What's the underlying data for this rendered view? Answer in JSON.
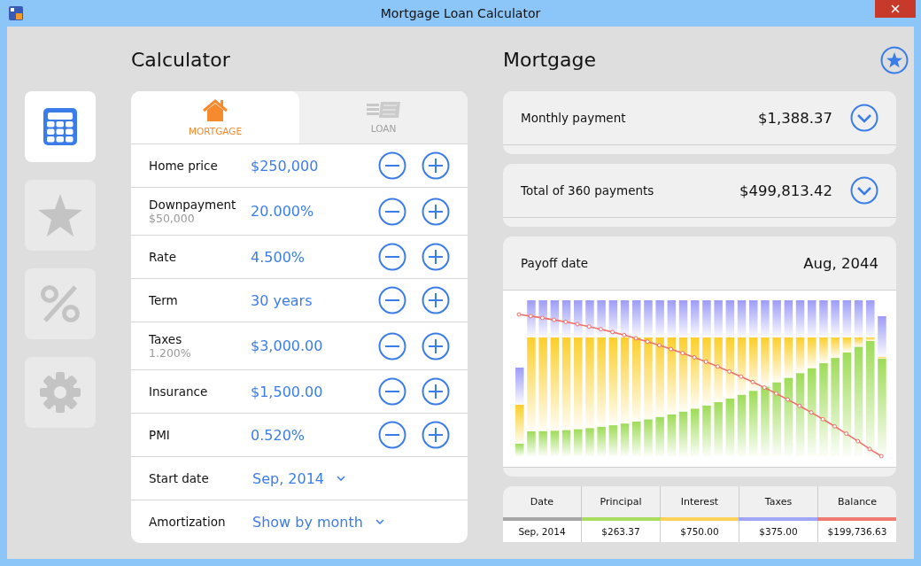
{
  "window": {
    "title": "Mortgage Loan Calculator"
  },
  "sidebar": {
    "items": [
      {
        "selected": true
      },
      {
        "selected": false
      },
      {
        "selected": false
      },
      {
        "selected": false
      }
    ]
  },
  "calculator": {
    "title": "Calculator",
    "tabs": [
      {
        "label": "MORTGAGE",
        "selected": true
      },
      {
        "label": "LOAN",
        "selected": false
      }
    ],
    "rows": [
      {
        "kind": "stepper",
        "label": "Home price",
        "value": "$250,000"
      },
      {
        "kind": "stepper",
        "label": "Downpayment",
        "sub": "$50,000",
        "value": "20.000%"
      },
      {
        "kind": "stepper",
        "label": "Rate",
        "value": "4.500%"
      },
      {
        "kind": "stepper",
        "label": "Term",
        "value": "30 years"
      },
      {
        "kind": "stepper",
        "label": "Taxes",
        "sub": "1.200%",
        "value": "$3,000.00"
      },
      {
        "kind": "stepper",
        "label": "Insurance",
        "value": "$1,500.00"
      },
      {
        "kind": "stepper",
        "label": "PMI",
        "value": "0.520%"
      },
      {
        "kind": "dropdown",
        "label": "Start date",
        "value": "Sep, 2014"
      },
      {
        "kind": "dropdown",
        "label": "Amortization",
        "value": "Show by month"
      }
    ]
  },
  "mortgage": {
    "title": "Mortgage",
    "summary": [
      {
        "label": "Monthly payment",
        "value": "$1,388.37",
        "expandable": true
      },
      {
        "label": "Total of 360 payments",
        "value": "$499,813.42",
        "expandable": true
      },
      {
        "label": "Payoff date",
        "value": "Aug, 2044",
        "expandable": false
      }
    ],
    "table": {
      "columns": [
        {
          "label": "Date",
          "color": "#a6a6a6"
        },
        {
          "label": "Principal",
          "color": "#a8de5e"
        },
        {
          "label": "Interest",
          "color": "#fbd157"
        },
        {
          "label": "Taxes",
          "color": "#a0a6f6"
        },
        {
          "label": "Balance",
          "color": "#f07b72"
        }
      ],
      "rows": [
        [
          "Sep, 2014",
          "$263.37",
          "$750.00",
          "$375.00",
          "$199,736.63"
        ]
      ]
    }
  }
}
